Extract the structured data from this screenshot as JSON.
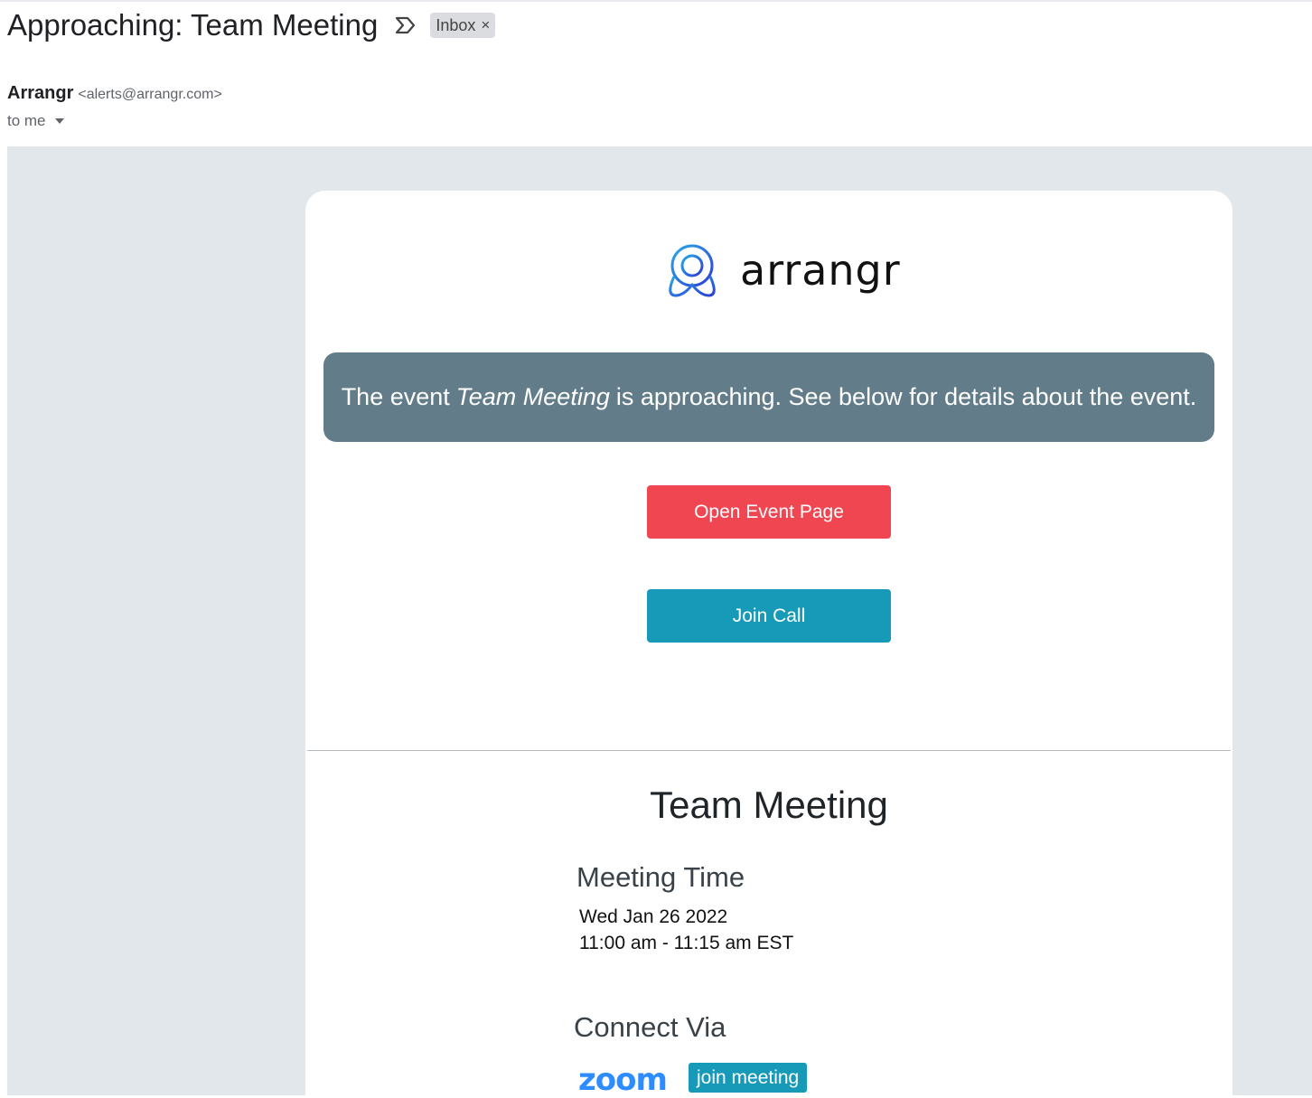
{
  "email": {
    "subject": "Approaching: Team Meeting",
    "label": "Inbox",
    "label_remove": "×",
    "sender_name": "Arrangr",
    "sender_email": "<alerts@arrangr.com>",
    "recipient": "to me"
  },
  "body": {
    "logo_text": "arrangr",
    "banner": {
      "prefix": "The event",
      "event_name": "Team Meeting",
      "suffix": "is approaching. See below for details about the event."
    },
    "open_event_button": "Open Event Page",
    "join_call_button": "Join Call",
    "event_title": "Team Meeting",
    "meeting_time_heading": "Meeting Time",
    "meeting_date": "Wed Jan 26 2022",
    "meeting_time": "11:00 am - 11:15 am EST",
    "connect_heading": "Connect Via",
    "zoom_logo": "zoom",
    "join_meeting_button": "join meeting"
  },
  "colors": {
    "banner": "#627d89",
    "open_event": "#ef4652",
    "join_call": "#1799b8",
    "zoom": "#2d8cff",
    "mail_background": "#e2e7eb"
  }
}
